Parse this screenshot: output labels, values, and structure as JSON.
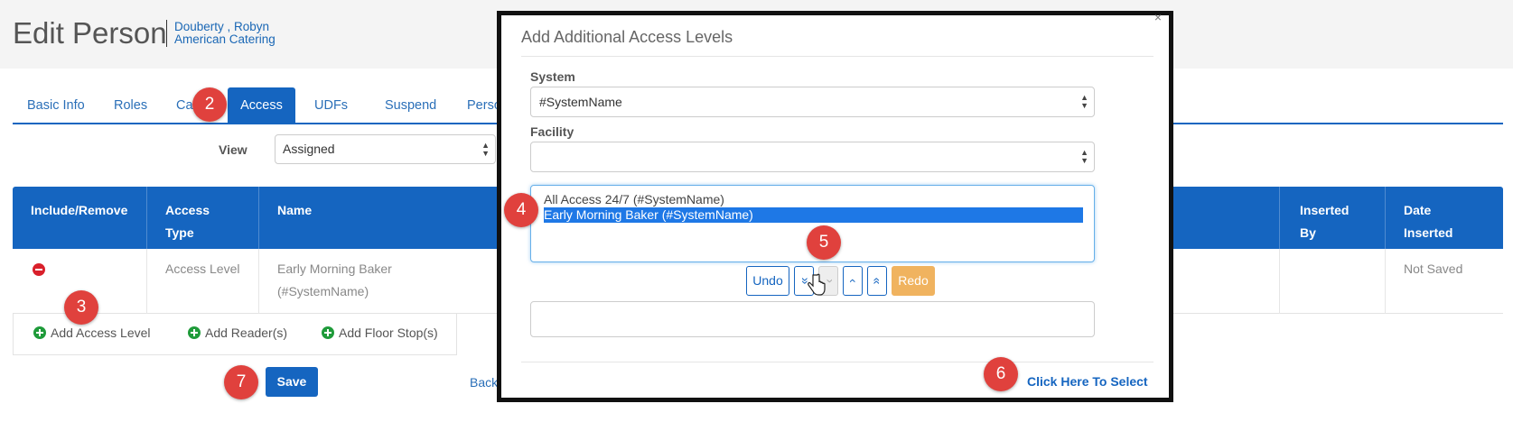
{
  "header": {
    "title": "Edit Person",
    "person_name": "Douberty , Robyn",
    "person_org": "American Catering"
  },
  "tabs": [
    {
      "label": "Basic Info"
    },
    {
      "label": "Roles"
    },
    {
      "label": "Ca"
    },
    {
      "label": "Access",
      "active": true
    },
    {
      "label": "UDFs"
    },
    {
      "label": "Suspend"
    },
    {
      "label": "Person"
    }
  ],
  "view": {
    "label": "View",
    "selected": "Assigned"
  },
  "table": {
    "headers": {
      "include_remove": "Include/Remove",
      "access_type_1": "Access",
      "access_type_2": "Type",
      "name": "Name",
      "inserted_by_1": "Inserted",
      "inserted_by_2": "By",
      "date_inserted_1": "Date",
      "date_inserted_2": "Inserted"
    },
    "rows": [
      {
        "access_type": "Access Level",
        "name_line1": "Early Morning Baker",
        "name_line2": "(#SystemName)",
        "inserted_by": "",
        "date_inserted": "Not Saved"
      }
    ]
  },
  "add_actions": {
    "access_level": "Add Access Level",
    "readers": "Add Reader(s)",
    "floor_stops": "Add Floor Stop(s)"
  },
  "footer": {
    "save_label": "Save",
    "back_label": "Back"
  },
  "modal": {
    "title": "Add Additional Access Levels",
    "close": "×",
    "system_label": "System",
    "system_value": "#SystemName",
    "facility_label": "Facility",
    "facility_value": "",
    "list_options": [
      {
        "label": "All Access 24/7 (#SystemName)",
        "selected": false
      },
      {
        "label": "Early Morning Baker (#SystemName)",
        "selected": true
      }
    ],
    "controls": {
      "undo": "Undo",
      "bottom": "«",
      "down": "‹",
      "up": "‹",
      "top": "«",
      "redo": "Redo"
    },
    "select_link": "Click Here To Select"
  },
  "markers": {
    "m2": "2",
    "m3": "3",
    "m4": "4",
    "m5": "5",
    "m6": "6",
    "m7": "7"
  },
  "colors": {
    "primary": "#1565c0",
    "marker": "#e0413d",
    "remove": "#d9202b",
    "add": "#1f9b3a",
    "redo": "#f0b35f"
  }
}
